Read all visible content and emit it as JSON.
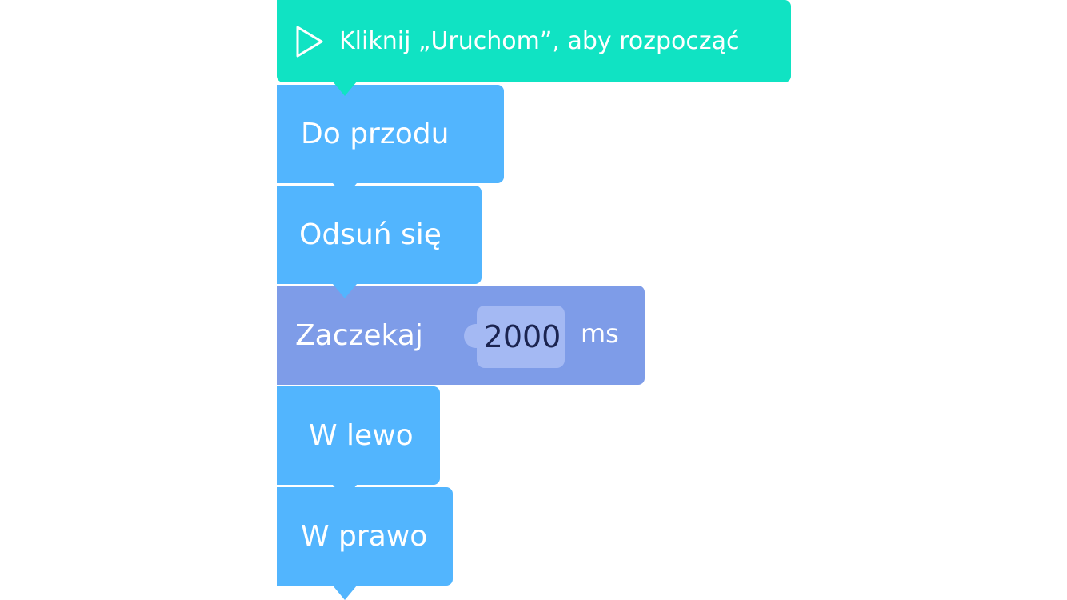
{
  "start_block": {
    "label": "Kliknij „Uruchom”, aby rozpocząć",
    "icon": "play-icon",
    "color": "#10e3c3"
  },
  "blocks": [
    {
      "label": "Do przodu",
      "color": "#52b5fe"
    },
    {
      "label": "Odsuń się",
      "color": "#52b5fe"
    },
    {
      "label": "Zaczekaj",
      "value": "2000",
      "unit": "ms",
      "color": "#7e9ce8"
    },
    {
      "label": "W lewo",
      "color": "#52b5fe"
    },
    {
      "label": "W prawo",
      "color": "#52b5fe"
    }
  ]
}
